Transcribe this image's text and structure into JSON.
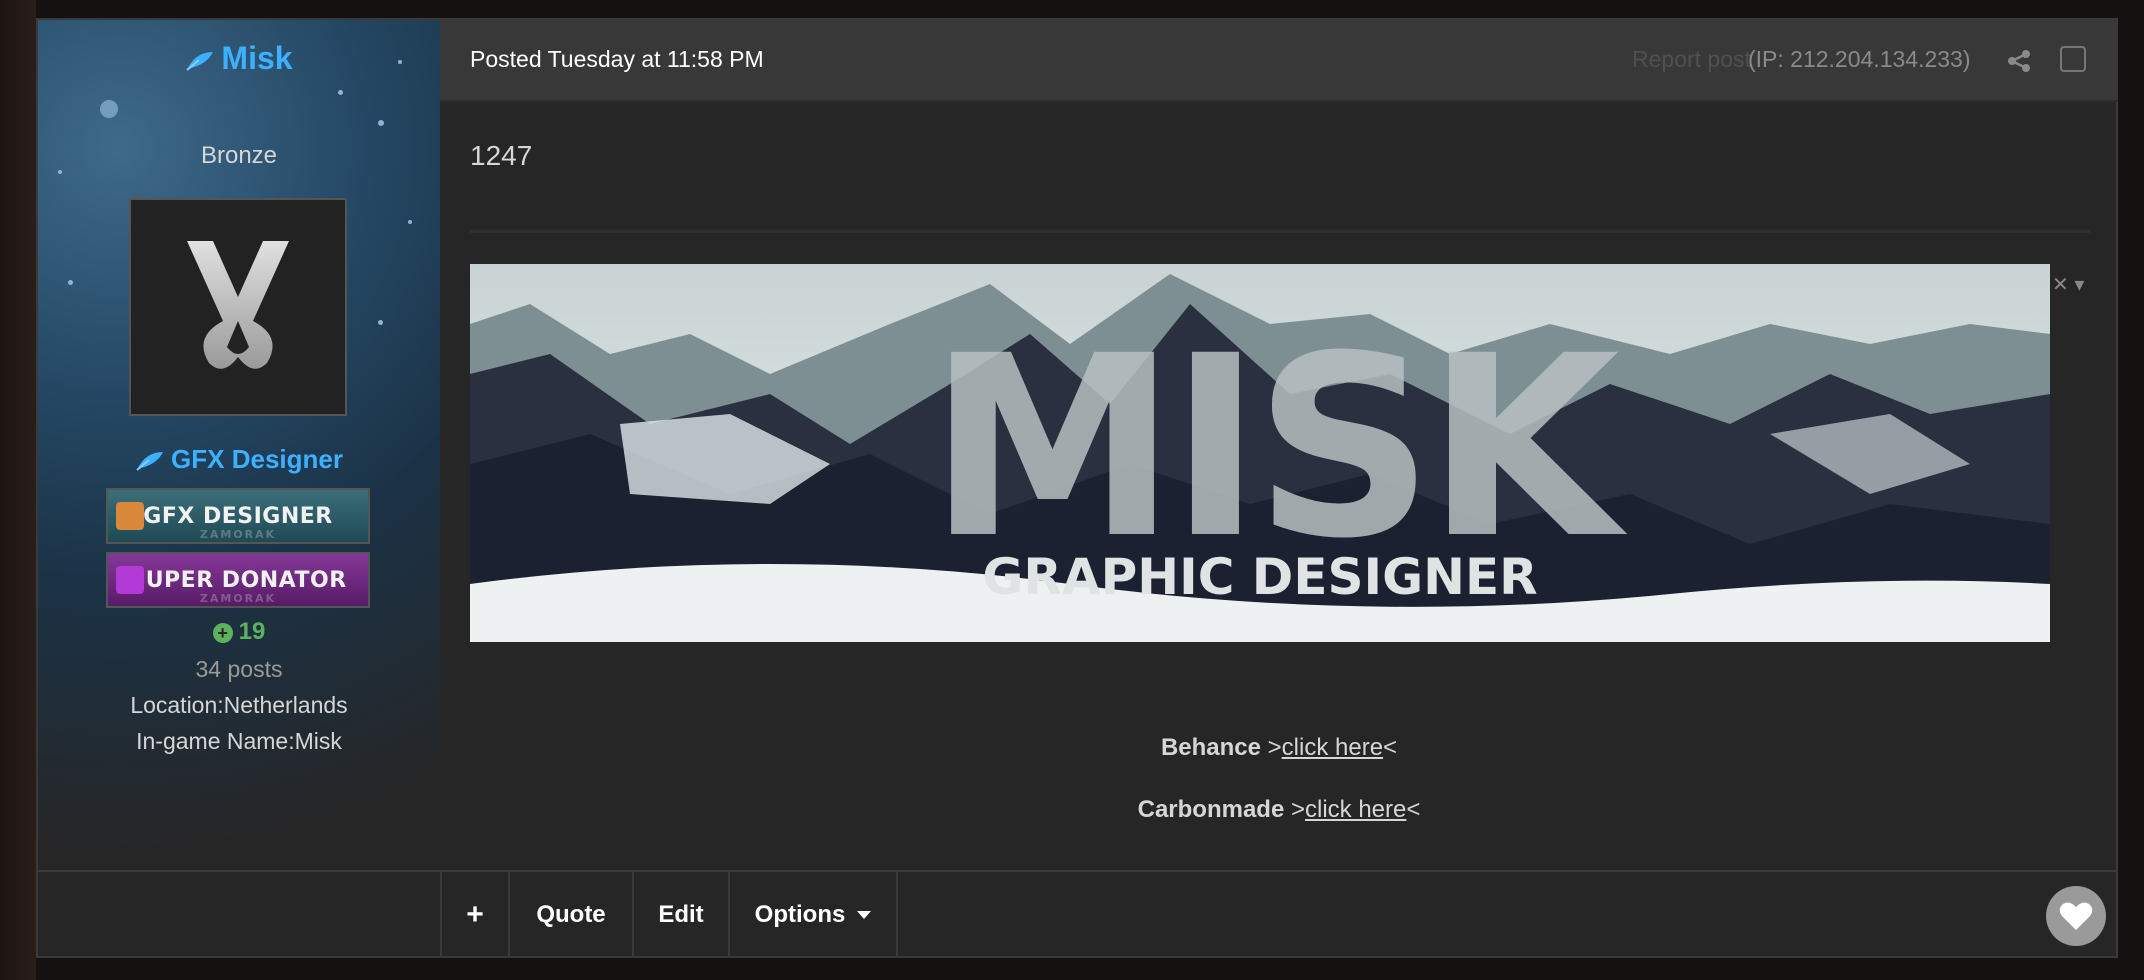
{
  "user": {
    "name": "Misk",
    "rank": "Bronze",
    "group": "GFX Designer",
    "badges": [
      {
        "title": "GFX DESIGNER",
        "sub": "ZAMORAK"
      },
      {
        "title": "SUPER DONATOR",
        "sub": "ZAMORAK"
      }
    ],
    "reputation": "19",
    "posts": "34 posts",
    "location": "Location:Netherlands",
    "ingame_name": "In-game Name:Misk"
  },
  "header": {
    "posted": "Posted Tuesday at 11:58 PM",
    "report": "Report post",
    "ip": "(IP: 212.204.134.233)"
  },
  "content": {
    "text": "1247",
    "banner": {
      "title": "MISK",
      "subtitle": "GRAPHIC DESIGNER"
    },
    "links": [
      {
        "label": "Behance",
        "pre": " >",
        "link": "click here",
        "post": "<"
      },
      {
        "label": "Carbonmade",
        "pre": " >",
        "link": "click here",
        "post": "<"
      }
    ]
  },
  "footer": {
    "plus": "+",
    "quote": "Quote",
    "edit": "Edit",
    "options": "Options"
  },
  "colors": {
    "accent": "#3db0ff",
    "reputation": "#5db25d",
    "background": "#262626",
    "header": "#383838"
  }
}
